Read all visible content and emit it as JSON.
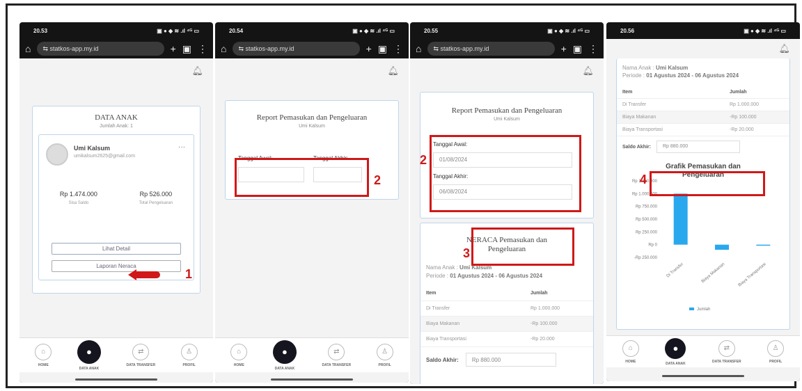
{
  "status_bar": {
    "icons": "▣ ● ◆ ≋ .ıl ⁴ᴳ ▭"
  },
  "url": "statkos-app.my.id",
  "nav": [
    "HOME",
    "DATA ANAK",
    "DATA TRANSFER",
    "PROFIL"
  ],
  "p1": {
    "time": "20.53",
    "title": "DATA ANAK",
    "subtitle": "Jumlah Anak: 1",
    "child_name": "Umi Kalsum",
    "child_email": "umikalsum2625@gmail.com",
    "saldo_value": "Rp 1.474.000",
    "saldo_label": "Sisa Saldo",
    "peng_value": "Rp 526.000",
    "peng_label": "Total Pengeluaran",
    "btn_detail": "Lihat Detail",
    "btn_laporan": "Laporan Neraca",
    "marker": "1"
  },
  "p2": {
    "time": "20.54",
    "title": "Report Pemasukan dan Pengeluaran",
    "subtitle": "Umi Kalsum",
    "awal_label": "Tanggal Awal:",
    "akhir_label": "Tanggal Akhir:",
    "marker": "2"
  },
  "p3": {
    "time": "20.55",
    "title": "Report Pemasukan dan Pengeluaran",
    "subtitle": "Umi Kalsum",
    "awal_label": "Tanggal Awal:",
    "awal_value": "01/08/2024",
    "akhir_label": "Tanggal Akhir:",
    "akhir_value": "06/08/2024",
    "marker2": "2",
    "neraca_title": "NERACA Pemasukan dan Pengeluaran",
    "marker3": "3",
    "nama_label": "Nama Anak :",
    "nama_value": "Umi Kalsum",
    "periode_label": "Periode :",
    "periode_value": "01 Agustus 2024 - 06 Agustus 2024",
    "col_item": "Item",
    "col_jumlah": "Jumlah",
    "rows": [
      {
        "item": "Di Transfer",
        "jumlah": "Rp 1.000.000"
      },
      {
        "item": "Biaya Makanan",
        "jumlah": "-Rp 100.000"
      },
      {
        "item": "Biaya Transportasi",
        "jumlah": "-Rp 20.000"
      }
    ],
    "saldo_label": "Saldo Akhir:",
    "saldo_value": "Rp 880.000"
  },
  "p4": {
    "time": "20.56",
    "nama_label": "Nama Anak :",
    "nama_value": "Umi Kalsum",
    "periode_label": "Periode :",
    "periode_value": "01 Agustus 2024 - 06 Agustus 2024",
    "col_item": "Item",
    "col_jumlah": "Jumlah",
    "rows": [
      {
        "item": "Di Transfer",
        "jumlah": "Rp 1.000.000"
      },
      {
        "item": "Biaya Makanan",
        "jumlah": "-Rp 100.000"
      },
      {
        "item": "Biaya Transportasi",
        "jumlah": "-Rp 20.000"
      }
    ],
    "saldo_label": "Saldo Akhir:",
    "saldo_value": "Rp 880.000",
    "grafik_title": "Grafik Pemasukan dan Pengeluaran",
    "marker": "4"
  },
  "chart_data": {
    "type": "bar",
    "categories": [
      "Di Transfer",
      "Biaya Makanan",
      "Biaya Transportasi"
    ],
    "values": [
      1000000,
      -100000,
      -20000
    ],
    "series": [
      {
        "name": "Jumlah",
        "values": [
          1000000,
          -100000,
          -20000
        ]
      }
    ],
    "y_ticks": [
      "Rp 1.250.000",
      "Rp 1.000.000",
      "Rp 750.000",
      "Rp 500.000",
      "Rp 250.000",
      "Rp 0",
      "-Rp 250.000"
    ],
    "ylim": [
      -250000,
      1250000
    ],
    "legend": "bottom",
    "color": "#2aa8ee"
  }
}
